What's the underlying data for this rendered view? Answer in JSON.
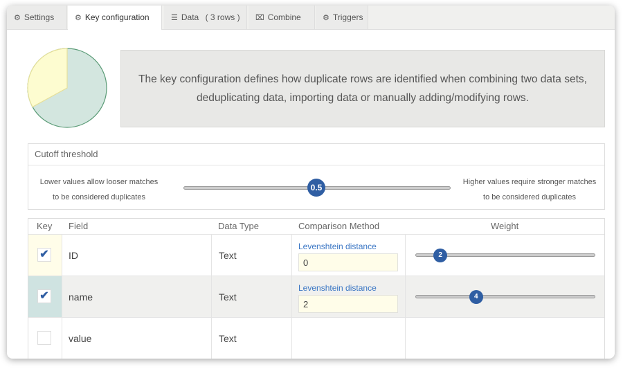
{
  "tabs": [
    {
      "label": "Settings",
      "icon": "gear-icon"
    },
    {
      "label": "Key configuration",
      "icon": "gears-icon",
      "active": true
    },
    {
      "label": "Data",
      "icon": "list-icon",
      "count": "( 3 rows )"
    },
    {
      "label": "Combine",
      "icon": "combine-icon"
    },
    {
      "label": "Triggers",
      "icon": "gears-icon"
    }
  ],
  "info": {
    "text": "The key configuration defines how duplicate rows are identified when combining two data sets, deduplicating data, importing data or manually adding/modifying rows."
  },
  "pie": {
    "key_fraction": 0.33,
    "colors": {
      "key": "#fdfcd0",
      "rest": "#d3e6df"
    }
  },
  "cutoff": {
    "title": "Cutoff threshold",
    "left_text": "Lower values allow looser matches to be considered duplicates",
    "right_text": "Higher values require stronger matches to be considered duplicates",
    "value": "0.5",
    "fraction": 0.5
  },
  "grid": {
    "headers": {
      "key": "Key",
      "field": "Field",
      "type": "Data Type",
      "method": "Comparison Method",
      "weight": "Weight"
    },
    "rows": [
      {
        "checked": "✔",
        "field": "ID",
        "type": "Text",
        "method": "Levenshtein distance",
        "method_value": "0",
        "weight": "2",
        "weight_fraction": 0.14
      },
      {
        "checked": "✔",
        "field": "name",
        "type": "Text",
        "method": "Levenshtein distance",
        "method_value": "2",
        "weight": "4",
        "weight_fraction": 0.34
      },
      {
        "checked": "",
        "field": "value",
        "type": "Text"
      }
    ]
  },
  "colors": {
    "accent": "#2f5ea3",
    "link": "#3a76c4",
    "panel": "#e8e8e6"
  }
}
